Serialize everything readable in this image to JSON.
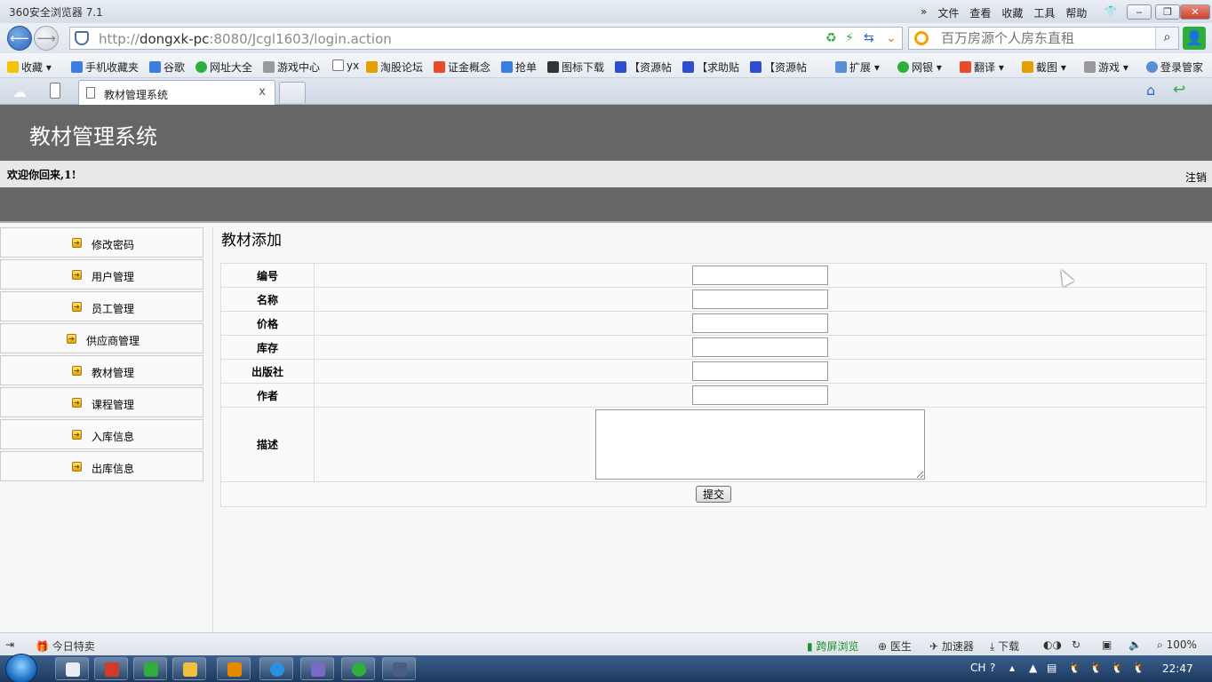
{
  "browser": {
    "app_title": "360安全浏览器 7.1",
    "menus": [
      "»",
      "文件",
      "查看",
      "收藏",
      "工具",
      "帮助"
    ],
    "url_prefix": "http://",
    "url_host": "dongxk-pc",
    "url_rest": ":8080/Jcgl1603/login.action",
    "search_placeholder": "百万房源个人房东直租",
    "favorites": [
      "收藏",
      "手机收藏夹",
      "谷歌",
      "网址大全",
      "游戏中心",
      "yx",
      "淘股论坛",
      "证金概念",
      "抢单",
      "图标下载",
      "【资源帖",
      "【求助贴",
      "【资源帖",
      "扩展",
      "网银",
      "翻译",
      "截图",
      "游戏",
      "登录管家"
    ],
    "tab_title": "教材管理系统",
    "tab_close": "x"
  },
  "page": {
    "system_title": "教材管理系统",
    "welcome": "欢迎你回来,1!",
    "logout": "注销",
    "sidebar": [
      {
        "label": "修改密码"
      },
      {
        "label": "用户管理"
      },
      {
        "label": "员工管理"
      },
      {
        "label": "供应商管理"
      },
      {
        "label": "教材管理"
      },
      {
        "label": "课程管理"
      },
      {
        "label": "入库信息"
      },
      {
        "label": "出库信息"
      }
    ],
    "form": {
      "heading": "教材添加",
      "fields": {
        "code": {
          "label": "编号",
          "value": ""
        },
        "name": {
          "label": "名称",
          "value": ""
        },
        "price": {
          "label": "价格",
          "value": ""
        },
        "stock": {
          "label": "库存",
          "value": ""
        },
        "publisher": {
          "label": "出版社",
          "value": ""
        },
        "author": {
          "label": "作者",
          "value": ""
        },
        "description": {
          "label": "描述",
          "value": ""
        }
      },
      "submit_label": "提交"
    }
  },
  "statusbar": {
    "left": "今日特卖",
    "items": [
      "跨屏浏览",
      "医生",
      "加速器",
      "下载",
      "100%"
    ]
  },
  "taskbar": {
    "lang": "CH",
    "clock": "22:47"
  },
  "colors": {
    "header_bg": "#666666",
    "welcome_bg": "#e8e8e8",
    "accent_green": "#1b8d2a"
  }
}
